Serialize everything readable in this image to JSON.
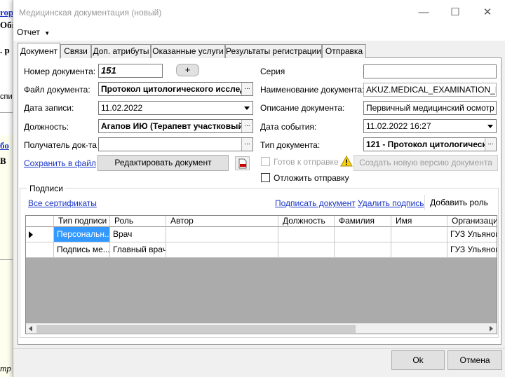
{
  "background": {
    "frag1": "ropo",
    "frag2": "Обі",
    "frag3": ". р",
    "frag4": "спи",
    "frag5": "бо",
    "frag6": "В",
    "frag7": "тр"
  },
  "window": {
    "title": "Медицинская документация (новый)"
  },
  "menu": {
    "report": "Отчет"
  },
  "tabs": [
    {
      "label": "Документ"
    },
    {
      "label": "Связи"
    },
    {
      "label": "Доп. атрибуты"
    },
    {
      "label": "Оказанные услуги"
    },
    {
      "label": "Результаты регистрации"
    },
    {
      "label": "Отправка"
    }
  ],
  "form": {
    "doc_number_label": "Номер документа:",
    "doc_number_value": "151",
    "plus_button": "+",
    "doc_file_label": "Файл документа:",
    "doc_file_value": "Протокол цитологического исслед",
    "record_date_label": "Дата записи:",
    "record_date_value": "11.02.2022",
    "position_label": "Должность:",
    "position_value": "Агапов ИЮ (Терапевт участковый)",
    "recipient_label": "Получатель док-та",
    "recipient_value": "",
    "series_label": "Серия",
    "series_value": "",
    "doc_name_label": "Наименование документа:",
    "doc_name_value": "AKUZ.MEDICAL_EXAMINATION_MAIN",
    "doc_desc_label": "Описание документа:",
    "doc_desc_value": "Первичный медицинский осмотр",
    "event_date_label": "Дата события:",
    "event_date_value": "11.02.2022 16:27",
    "doc_type_label": "Тип документа:",
    "doc_type_value": "121 - Протокол цитологическ",
    "save_to_file": "Сохранить в файл",
    "edit_document": "Редактировать документ",
    "ready_to_send": "Готов к отправке",
    "create_new_version": "Создать новую версию документа",
    "postpone_sending": "Отложить отправку"
  },
  "signatures": {
    "title": "Подписи",
    "all_certificates": "Все сертификаты",
    "sign_document": "Подписать документ",
    "delete_signature": "Удалить подпись",
    "add_role": "Добавить роль",
    "columns": [
      "Тип подписи",
      "Роль",
      "Автор",
      "Должность",
      "Фамилия",
      "Имя",
      "Организация"
    ],
    "rows": [
      [
        "Персональн...",
        "Врач",
        "",
        "",
        "",
        "",
        "ГУЗ Ульянов"
      ],
      [
        "Подпись ме...",
        "Главный врач",
        "",
        "",
        "",
        "",
        "ГУЗ Ульянов"
      ]
    ]
  },
  "footer": {
    "ok": "Ok",
    "cancel": "Отмена"
  }
}
